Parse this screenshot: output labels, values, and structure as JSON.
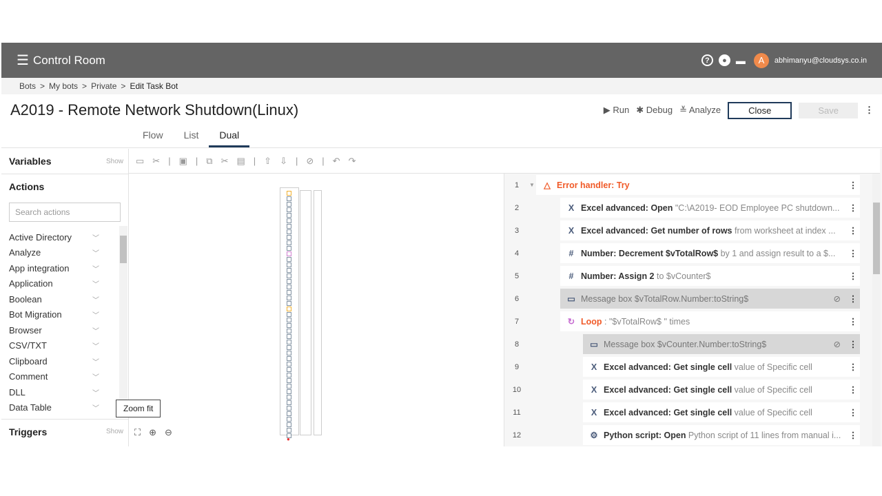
{
  "header": {
    "brand": "Control Room",
    "user_initial": "A",
    "user_email": "abhimanyu@cloudsys.co.in"
  },
  "breadcrumb": [
    "Bots",
    ">",
    "My bots",
    ">",
    "Private",
    ">",
    "Edit Task Bot"
  ],
  "page": {
    "title": "A2019 - Remote Network Shutdown(Linux)",
    "run": "Run",
    "debug": "Debug",
    "analyze": "Analyze",
    "close": "Close",
    "save": "Save"
  },
  "tabs": [
    "Flow",
    "List",
    "Dual"
  ],
  "left": {
    "variables": "Variables",
    "show": "Show",
    "actions": "Actions",
    "search_placeholder": "Search actions",
    "triggers": "Triggers",
    "items": [
      "Active Directory",
      "Analyze",
      "App integration",
      "Application",
      "Boolean",
      "Bot Migration",
      "Browser",
      "CSV/TXT",
      "Clipboard",
      "Comment",
      "DLL",
      "Data Table"
    ]
  },
  "canvas": {
    "tooltip": "Zoom fit"
  },
  "steps": [
    {
      "n": "1",
      "icon": "△",
      "bold": "Error handler: Try",
      "rest": "",
      "type": "error"
    },
    {
      "n": "2",
      "icon": "X",
      "bold": "Excel advanced: Open",
      "rest": " \"C:\\A2019- EOD Employee PC shutdown..."
    },
    {
      "n": "3",
      "icon": "X",
      "bold": "Excel advanced: Get number of rows",
      "rest": " from worksheet at index ..."
    },
    {
      "n": "4",
      "icon": "#",
      "bold": "Number: Decrement $vTotalRow$",
      "rest": " by 1 and assign result to a $..."
    },
    {
      "n": "5",
      "icon": "#",
      "bold": "Number: Assign 2",
      "rest": " to $vCounter$"
    },
    {
      "n": "6",
      "icon": "▭",
      "bold": "Message box $vTotalRow.Number:toString$",
      "rest": "",
      "type": "disabled"
    },
    {
      "n": "7",
      "icon": "↻",
      "bold": "Loop",
      "rest": " : \"$vTotalRow$ \" times",
      "type": "loop"
    },
    {
      "n": "8",
      "icon": "▭",
      "bold": "Message box $vCounter.Number:toString$",
      "rest": "",
      "type": "disabled"
    },
    {
      "n": "9",
      "icon": "X",
      "bold": "Excel advanced: Get single cell",
      "rest": " value of Specific cell"
    },
    {
      "n": "10",
      "icon": "X",
      "bold": "Excel advanced: Get single cell",
      "rest": " value of Specific cell"
    },
    {
      "n": "11",
      "icon": "X",
      "bold": "Excel advanced: Get single cell",
      "rest": " value of Specific cell"
    },
    {
      "n": "12",
      "icon": "⚙",
      "bold": "Python script: Open",
      "rest": " Python script of 11 lines from manual i..."
    }
  ],
  "colors": {
    "header": "#646464",
    "accent": "#1f3a5a",
    "error": "#f05a28",
    "loop": "#c56bd0"
  }
}
